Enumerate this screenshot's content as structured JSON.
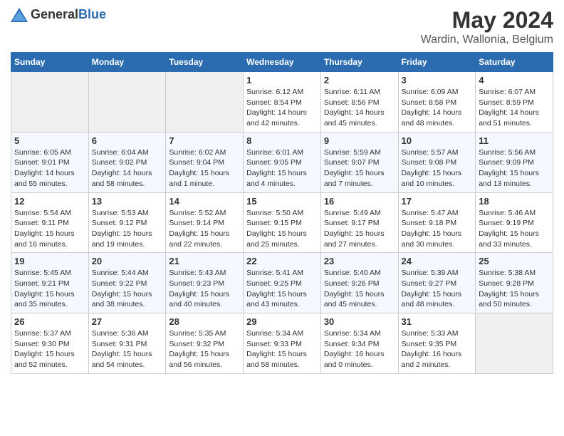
{
  "header": {
    "logo": {
      "general": "General",
      "blue": "Blue"
    },
    "title": "May 2024",
    "subtitle": "Wardin, Wallonia, Belgium"
  },
  "weekdays": [
    "Sunday",
    "Monday",
    "Tuesday",
    "Wednesday",
    "Thursday",
    "Friday",
    "Saturday"
  ],
  "weeks": [
    [
      {
        "day": "",
        "empty": true
      },
      {
        "day": "",
        "empty": true
      },
      {
        "day": "",
        "empty": true
      },
      {
        "day": "1",
        "sunrise": "Sunrise: 6:12 AM",
        "sunset": "Sunset: 8:54 PM",
        "daylight": "Daylight: 14 hours and 42 minutes."
      },
      {
        "day": "2",
        "sunrise": "Sunrise: 6:11 AM",
        "sunset": "Sunset: 8:56 PM",
        "daylight": "Daylight: 14 hours and 45 minutes."
      },
      {
        "day": "3",
        "sunrise": "Sunrise: 6:09 AM",
        "sunset": "Sunset: 8:58 PM",
        "daylight": "Daylight: 14 hours and 48 minutes."
      },
      {
        "day": "4",
        "sunrise": "Sunrise: 6:07 AM",
        "sunset": "Sunset: 8:59 PM",
        "daylight": "Daylight: 14 hours and 51 minutes."
      }
    ],
    [
      {
        "day": "5",
        "sunrise": "Sunrise: 6:05 AM",
        "sunset": "Sunset: 9:01 PM",
        "daylight": "Daylight: 14 hours and 55 minutes."
      },
      {
        "day": "6",
        "sunrise": "Sunrise: 6:04 AM",
        "sunset": "Sunset: 9:02 PM",
        "daylight": "Daylight: 14 hours and 58 minutes."
      },
      {
        "day": "7",
        "sunrise": "Sunrise: 6:02 AM",
        "sunset": "Sunset: 9:04 PM",
        "daylight": "Daylight: 15 hours and 1 minute."
      },
      {
        "day": "8",
        "sunrise": "Sunrise: 6:01 AM",
        "sunset": "Sunset: 9:05 PM",
        "daylight": "Daylight: 15 hours and 4 minutes."
      },
      {
        "day": "9",
        "sunrise": "Sunrise: 5:59 AM",
        "sunset": "Sunset: 9:07 PM",
        "daylight": "Daylight: 15 hours and 7 minutes."
      },
      {
        "day": "10",
        "sunrise": "Sunrise: 5:57 AM",
        "sunset": "Sunset: 9:08 PM",
        "daylight": "Daylight: 15 hours and 10 minutes."
      },
      {
        "day": "11",
        "sunrise": "Sunrise: 5:56 AM",
        "sunset": "Sunset: 9:09 PM",
        "daylight": "Daylight: 15 hours and 13 minutes."
      }
    ],
    [
      {
        "day": "12",
        "sunrise": "Sunrise: 5:54 AM",
        "sunset": "Sunset: 9:11 PM",
        "daylight": "Daylight: 15 hours and 16 minutes."
      },
      {
        "day": "13",
        "sunrise": "Sunrise: 5:53 AM",
        "sunset": "Sunset: 9:12 PM",
        "daylight": "Daylight: 15 hours and 19 minutes."
      },
      {
        "day": "14",
        "sunrise": "Sunrise: 5:52 AM",
        "sunset": "Sunset: 9:14 PM",
        "daylight": "Daylight: 15 hours and 22 minutes."
      },
      {
        "day": "15",
        "sunrise": "Sunrise: 5:50 AM",
        "sunset": "Sunset: 9:15 PM",
        "daylight": "Daylight: 15 hours and 25 minutes."
      },
      {
        "day": "16",
        "sunrise": "Sunrise: 5:49 AM",
        "sunset": "Sunset: 9:17 PM",
        "daylight": "Daylight: 15 hours and 27 minutes."
      },
      {
        "day": "17",
        "sunrise": "Sunrise: 5:47 AM",
        "sunset": "Sunset: 9:18 PM",
        "daylight": "Daylight: 15 hours and 30 minutes."
      },
      {
        "day": "18",
        "sunrise": "Sunrise: 5:46 AM",
        "sunset": "Sunset: 9:19 PM",
        "daylight": "Daylight: 15 hours and 33 minutes."
      }
    ],
    [
      {
        "day": "19",
        "sunrise": "Sunrise: 5:45 AM",
        "sunset": "Sunset: 9:21 PM",
        "daylight": "Daylight: 15 hours and 35 minutes."
      },
      {
        "day": "20",
        "sunrise": "Sunrise: 5:44 AM",
        "sunset": "Sunset: 9:22 PM",
        "daylight": "Daylight: 15 hours and 38 minutes."
      },
      {
        "day": "21",
        "sunrise": "Sunrise: 5:43 AM",
        "sunset": "Sunset: 9:23 PM",
        "daylight": "Daylight: 15 hours and 40 minutes."
      },
      {
        "day": "22",
        "sunrise": "Sunrise: 5:41 AM",
        "sunset": "Sunset: 9:25 PM",
        "daylight": "Daylight: 15 hours and 43 minutes."
      },
      {
        "day": "23",
        "sunrise": "Sunrise: 5:40 AM",
        "sunset": "Sunset: 9:26 PM",
        "daylight": "Daylight: 15 hours and 45 minutes."
      },
      {
        "day": "24",
        "sunrise": "Sunrise: 5:39 AM",
        "sunset": "Sunset: 9:27 PM",
        "daylight": "Daylight: 15 hours and 48 minutes."
      },
      {
        "day": "25",
        "sunrise": "Sunrise: 5:38 AM",
        "sunset": "Sunset: 9:28 PM",
        "daylight": "Daylight: 15 hours and 50 minutes."
      }
    ],
    [
      {
        "day": "26",
        "sunrise": "Sunrise: 5:37 AM",
        "sunset": "Sunset: 9:30 PM",
        "daylight": "Daylight: 15 hours and 52 minutes."
      },
      {
        "day": "27",
        "sunrise": "Sunrise: 5:36 AM",
        "sunset": "Sunset: 9:31 PM",
        "daylight": "Daylight: 15 hours and 54 minutes."
      },
      {
        "day": "28",
        "sunrise": "Sunrise: 5:35 AM",
        "sunset": "Sunset: 9:32 PM",
        "daylight": "Daylight: 15 hours and 56 minutes."
      },
      {
        "day": "29",
        "sunrise": "Sunrise: 5:34 AM",
        "sunset": "Sunset: 9:33 PM",
        "daylight": "Daylight: 15 hours and 58 minutes."
      },
      {
        "day": "30",
        "sunrise": "Sunrise: 5:34 AM",
        "sunset": "Sunset: 9:34 PM",
        "daylight": "Daylight: 16 hours and 0 minutes."
      },
      {
        "day": "31",
        "sunrise": "Sunrise: 5:33 AM",
        "sunset": "Sunset: 9:35 PM",
        "daylight": "Daylight: 16 hours and 2 minutes."
      },
      {
        "day": "",
        "empty": true
      }
    ]
  ]
}
